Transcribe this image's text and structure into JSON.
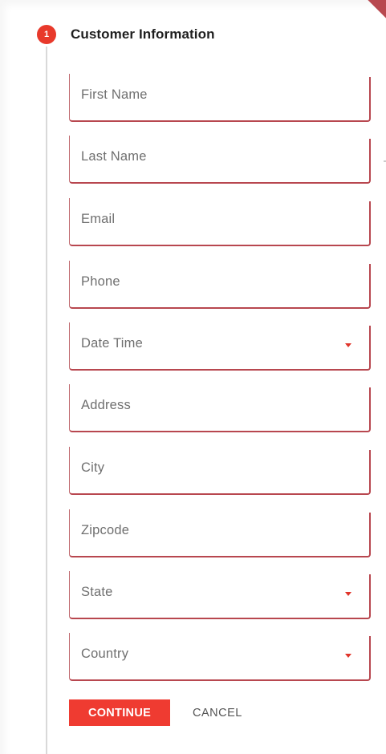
{
  "step": {
    "number": "1",
    "title": "Customer Information"
  },
  "fields": [
    {
      "label": "First Name"
    },
    {
      "label": "Last Name"
    },
    {
      "label": "Email"
    },
    {
      "label": "Phone"
    },
    {
      "label": "Date Time",
      "dropdown": true
    },
    {
      "label": "Address"
    },
    {
      "label": "City"
    },
    {
      "label": "Zipcode"
    },
    {
      "label": "State",
      "dropdown": true
    },
    {
      "label": "Country",
      "dropdown": true
    }
  ],
  "actions": {
    "continue_label": "CONTINUE",
    "cancel_label": "CANCEL"
  },
  "colors": {
    "accent": "#ef3b31",
    "field_border": "#b8474f",
    "badge": "#e8392b"
  },
  "icons": {
    "dropdown": "caret-down-icon"
  }
}
